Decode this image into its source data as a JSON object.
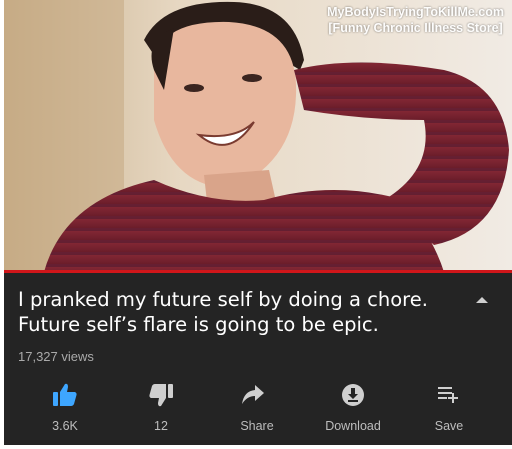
{
  "watermark": {
    "line1": "MyBodyIsTryingToKillMe.com",
    "line2": "[Funny Chronic Illness Store]"
  },
  "video": {
    "title_line1": "I pranked my future self by doing a chore.",
    "title_line2": "Future self’s flare is going to be epic.",
    "views": "17,327 views"
  },
  "actions": [
    {
      "icon": "thumbs-up-icon",
      "label": "3.6K",
      "active": true
    },
    {
      "icon": "thumbs-down-icon",
      "label": "12"
    },
    {
      "icon": "share-icon",
      "label": "Share"
    },
    {
      "icon": "download-icon",
      "label": "Download"
    },
    {
      "icon": "save-playlist-icon",
      "label": "Save"
    }
  ],
  "colors": {
    "accent": "#3ea6ff",
    "progress": "#d0161a",
    "panel": "#242424",
    "icon": "#cfcfcf"
  }
}
